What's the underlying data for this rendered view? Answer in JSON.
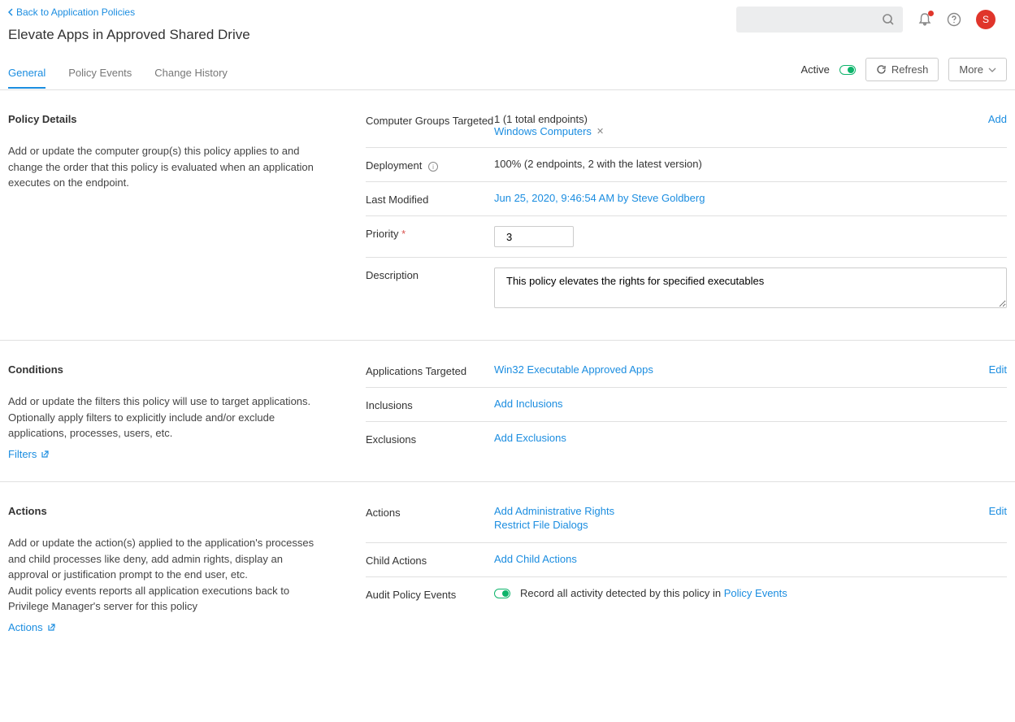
{
  "header": {
    "back_label": "Back to Application Policies",
    "page_title": "Elevate Apps in Approved Shared Drive",
    "avatar_initial": "S"
  },
  "tabs": {
    "general": "General",
    "policy_events": "Policy Events",
    "change_history": "Change History",
    "active_label": "Active",
    "refresh_label": "Refresh",
    "more_label": "More"
  },
  "policy_details": {
    "title": "Policy Details",
    "desc": "Add or update the computer group(s) this policy applies to and change the order that this policy is evaluated when an application executes on the endpoint.",
    "fields": {
      "computer_groups_label": "Computer Groups Targeted",
      "computer_groups_count": "1 (1 total endpoints)",
      "computer_groups_chip": "Windows Computers",
      "computer_groups_add": "Add",
      "deployment_label": "Deployment",
      "deployment_value": "100% (2 endpoints, 2 with the latest version)",
      "last_modified_label": "Last Modified",
      "last_modified_value": "Jun 25, 2020, 9:46:54 AM by Steve Goldberg",
      "priority_label": "Priority",
      "priority_value": "3",
      "description_label": "Description",
      "description_value": "This policy elevates the rights for specified executables"
    }
  },
  "conditions": {
    "title": "Conditions",
    "desc": "Add or update the filters this policy will use to target applications. Optionally apply filters to explicitly include and/or exclude applications, processes, users, etc.",
    "filters_link": "Filters",
    "fields": {
      "applications_label": "Applications Targeted",
      "applications_value": "Win32 Executable Approved Apps",
      "edit_label": "Edit",
      "inclusions_label": "Inclusions",
      "inclusions_link": "Add Inclusions",
      "exclusions_label": "Exclusions",
      "exclusions_link": "Add Exclusions"
    }
  },
  "actions": {
    "title": "Actions",
    "desc1": "Add or update the action(s) applied to the application's processes and child processes like deny, add admin rights, display an approval or justification prompt to the end user, etc.",
    "desc2": "Audit policy events reports all application executions back to Privilege Manager's server for this policy",
    "actions_link": "Actions",
    "fields": {
      "actions_label": "Actions",
      "action1": "Add Administrative Rights",
      "action2": "Restrict File Dialogs",
      "edit_label": "Edit",
      "child_label": "Child Actions",
      "child_link": "Add Child Actions",
      "audit_label": "Audit Policy Events",
      "audit_text": "Record all activity detected by this policy in ",
      "audit_link": "Policy Events"
    }
  }
}
